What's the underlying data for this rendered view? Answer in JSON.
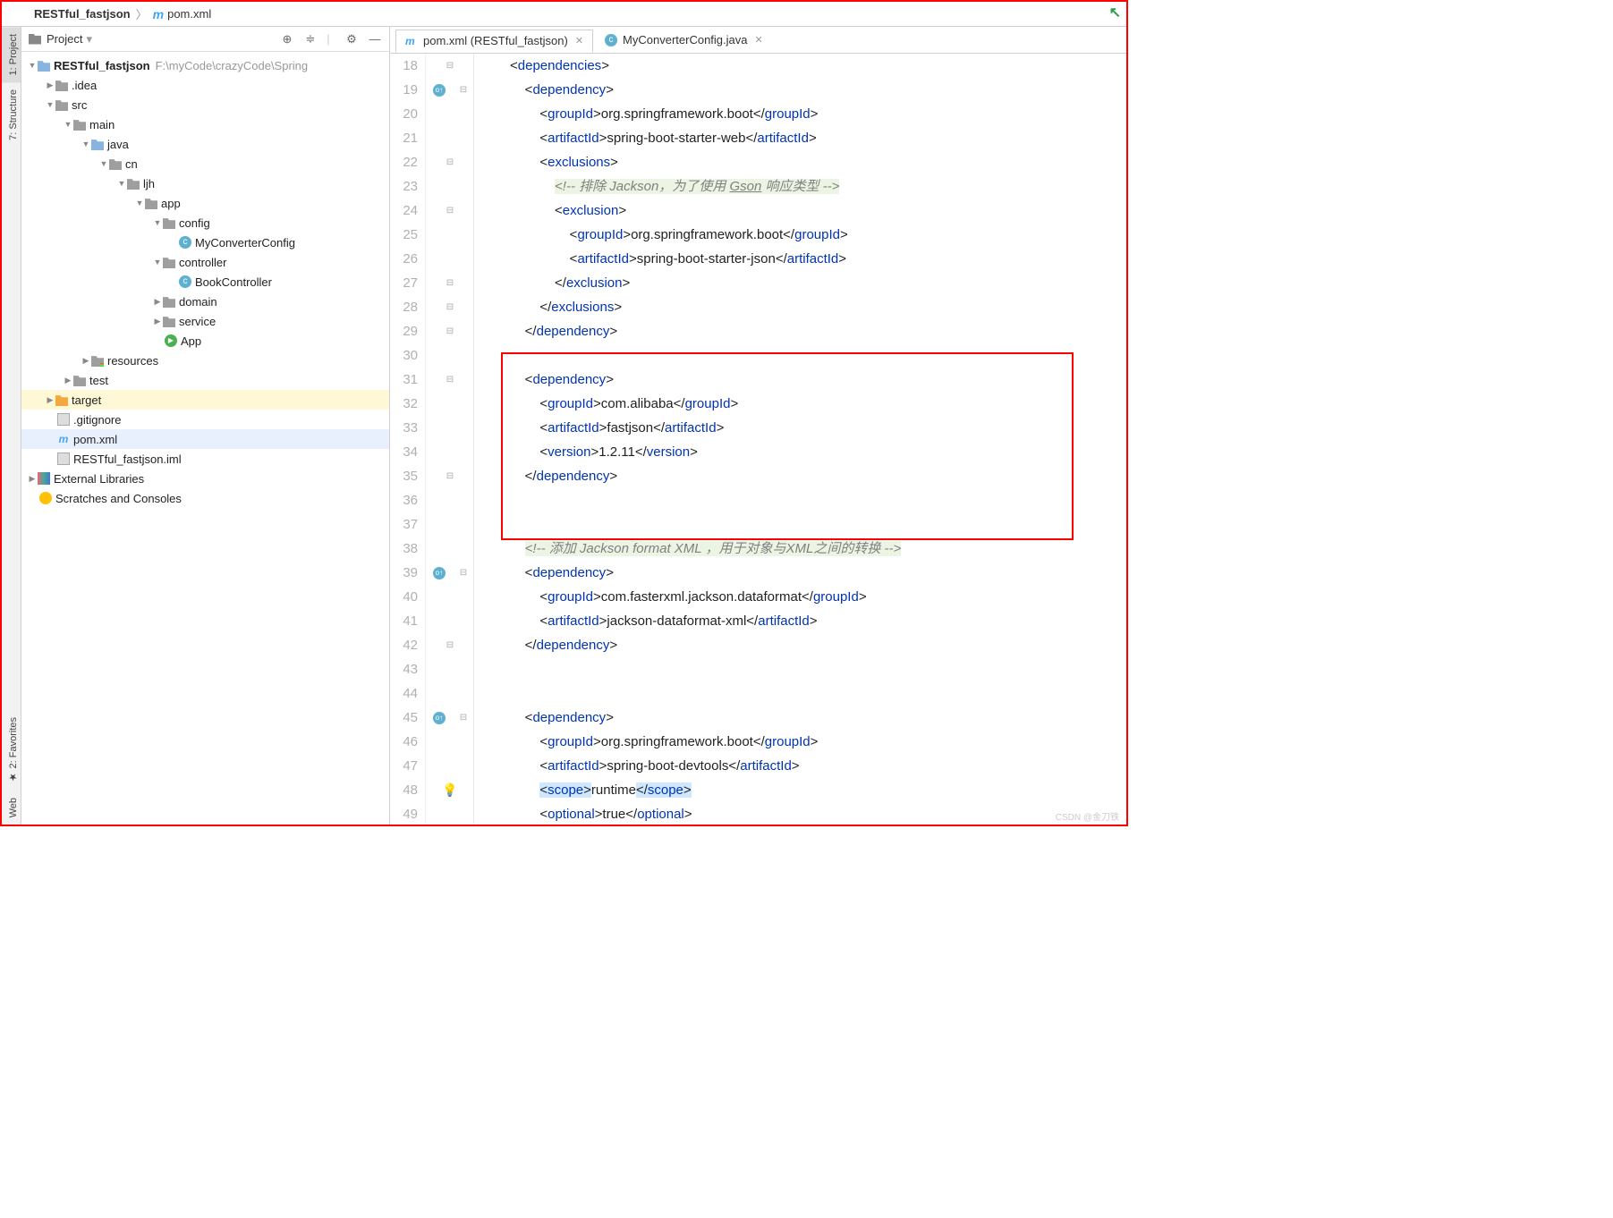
{
  "breadcrumb": {
    "project": "RESTful_fastjson",
    "file": "pom.xml"
  },
  "sideTabs": {
    "project": "1: Project",
    "structure": "7: Structure",
    "favorites": "2: Favorites",
    "web": "Web"
  },
  "projectPanel": {
    "title": "Project"
  },
  "tree": {
    "root": {
      "label": "RESTful_fastjson",
      "path": "F:\\myCode\\crazyCode\\Spring"
    },
    "idea": ".idea",
    "src": "src",
    "main": "main",
    "java": "java",
    "cn": "cn",
    "ljh": "ljh",
    "app": "app",
    "config": "config",
    "myConverter": "MyConverterConfig",
    "controller": "controller",
    "bookController": "BookController",
    "domain": "domain",
    "service": "service",
    "appClass": "App",
    "resources": "resources",
    "test": "test",
    "target": "target",
    "gitignore": ".gitignore",
    "pom": "pom.xml",
    "iml": "RESTful_fastjson.iml",
    "extLib": "External Libraries",
    "scratches": "Scratches and Consoles"
  },
  "editorTabs": {
    "t1": "pom.xml (RESTful_fastjson)",
    "t2": "MyConverterConfig.java"
  },
  "code": {
    "lines": [
      "18",
      "19",
      "20",
      "21",
      "22",
      "23",
      "24",
      "25",
      "26",
      "27",
      "28",
      "29",
      "30",
      "31",
      "32",
      "33",
      "34",
      "35",
      "36",
      "37",
      "38",
      "39",
      "40",
      "41",
      "42",
      "43",
      "44",
      "45",
      "46",
      "47",
      "48",
      "49"
    ],
    "l18": "<dependencies>",
    "l19_o": "<dependency>",
    "l20": {
      "p": "<",
      "t1": "groupId",
      "v": "org.springframework.boot",
      "c": "</",
      "t2": "groupId",
      "e": ">"
    },
    "l21": {
      "t1": "artifactId",
      "v": "spring-boot-starter-web"
    },
    "l22": "<exclusions>",
    "l23_cmt": "<!-- 排除 Jackson，为了使用 ",
    "l23_gson": "Gson",
    "l23_tail": " 响应类型 -->",
    "l24": "<exclusion>",
    "l25": {
      "t1": "groupId",
      "v": "org.springframework.boot"
    },
    "l26": {
      "t1": "artifactId",
      "v": "spring-boot-starter-json"
    },
    "l27": "</exclusion>",
    "l28": "</exclusions>",
    "l29": "</dependency>",
    "l31": "<dependency>",
    "l32": {
      "t1": "groupId",
      "v": "com.alibaba"
    },
    "l33": {
      "t1": "artifactId",
      "v": "fastjson"
    },
    "l34": {
      "t1": "version",
      "v": "1.2.11"
    },
    "l35": "</dependency>",
    "l38_cmt": "<!-- 添加 Jackson format XML ，用于对象与XML之间的转换 -->",
    "l39": "<dependency>",
    "l40": {
      "t1": "groupId",
      "v": "com.fasterxml.jackson.dataformat"
    },
    "l41": {
      "t1": "artifactId",
      "v": "jackson-dataformat-xml"
    },
    "l42": "</dependency>",
    "l45": "<dependency>",
    "l46": {
      "t1": "groupId",
      "v": "org.springframework.boot"
    },
    "l47": {
      "t1": "artifactId",
      "v": "spring-boot-devtools"
    },
    "l48": {
      "t1": "scope",
      "v": "runtime"
    },
    "l49": {
      "t1": "optional",
      "v": "true"
    }
  },
  "watermark": "CSDN @金刀铁"
}
